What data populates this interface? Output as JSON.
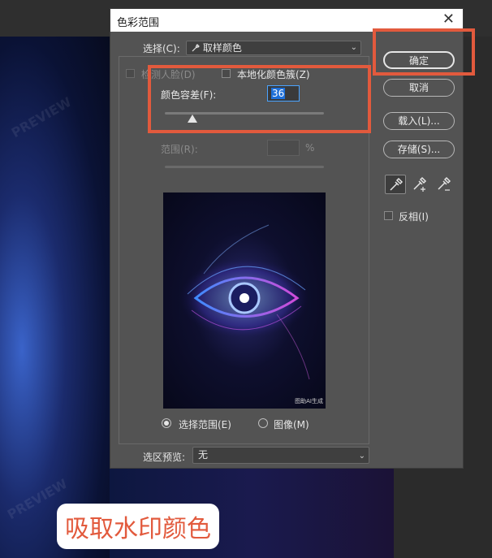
{
  "dialog": {
    "title": "色彩范围",
    "close_glyph": "✕",
    "select_label": "选择(C):",
    "select_value": "取样颜色",
    "detect_faces_label": "检测人脸(D)",
    "localized_label": "本地化颜色簇(Z)",
    "fuzziness_label": "颜色容差(F):",
    "fuzziness_value": "36",
    "range_label": "范围(R):",
    "range_unit": "%",
    "preview_badge": "图助AI生成",
    "radio_selection": "选择范围(E)",
    "radio_image": "图像(M)",
    "selection_preview_label": "选区预览:",
    "selection_preview_value": "无",
    "buttons": {
      "ok": "确定",
      "cancel": "取消",
      "load": "载入(L)...",
      "save": "存储(S)..."
    },
    "invert_label": "反相(I)",
    "tools": [
      "eyedropper-icon",
      "eyedropper-plus-icon",
      "eyedropper-minus-icon"
    ],
    "fuzziness_slider_fraction": 0.17
  },
  "caption": "吸取水印颜色",
  "watermark": "PREVIEW",
  "colors": {
    "highlight": "#e25a3d",
    "dialog_bg": "#535353",
    "field_focus": "#4aa3ff"
  }
}
